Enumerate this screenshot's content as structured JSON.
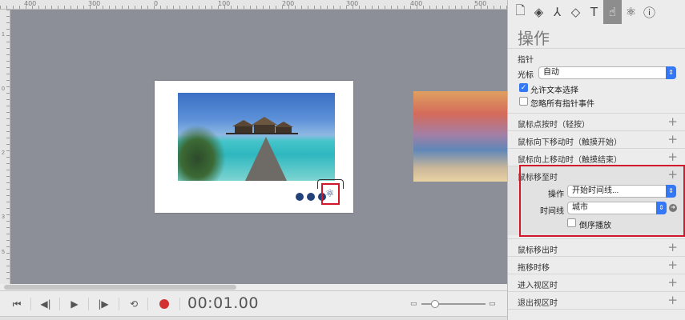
{
  "ruler": {
    "h_labels": [
      "400",
      "300",
      "200",
      "100",
      "0",
      "100",
      "200",
      "300",
      "400",
      "500",
      "600"
    ],
    "v_labels": [
      "1",
      "0",
      "0",
      "1",
      "0",
      "0",
      "2",
      "0",
      "0",
      "3",
      "0",
      "0",
      "4",
      "0",
      "0",
      "5",
      "0",
      "0"
    ]
  },
  "transport": {
    "timecode": "00:01.00"
  },
  "inspector": {
    "tabs": [
      {
        "name": "document-tab",
        "glyph": "🗋"
      },
      {
        "name": "layers-tab",
        "glyph": "◈"
      },
      {
        "name": "path-tab",
        "glyph": "⅄"
      },
      {
        "name": "shapes-tab",
        "glyph": "◇"
      },
      {
        "name": "text-tab",
        "glyph": "T"
      },
      {
        "name": "actions-tab",
        "glyph": "☝"
      },
      {
        "name": "physics-tab",
        "glyph": "⚛"
      },
      {
        "name": "info-tab",
        "glyph": "ⓘ"
      }
    ],
    "title": "操作",
    "pointer": {
      "section": "指针",
      "cursor_label": "光标",
      "cursor_value": "自动",
      "allow_text_select": "允许文本选择",
      "ignore_pointer_events": "忽略所有指针事件"
    },
    "events_top": [
      {
        "label": "鼠标点按时（轻按）"
      },
      {
        "label": "鼠标向下移动时（触摸开始）"
      },
      {
        "label": "鼠标向上移动时（触摸结束）"
      }
    ],
    "hover": {
      "label": "鼠标移至时",
      "action_label": "操作",
      "action_value": "开始时间线...",
      "timeline_label": "时间线",
      "timeline_value": "城市",
      "reverse_label": "倒序播放"
    },
    "events_bottom": [
      {
        "label": "鼠标移出时"
      },
      {
        "label": "拖移时移"
      },
      {
        "label": "进入视区时"
      },
      {
        "label": "退出视区时"
      }
    ]
  }
}
